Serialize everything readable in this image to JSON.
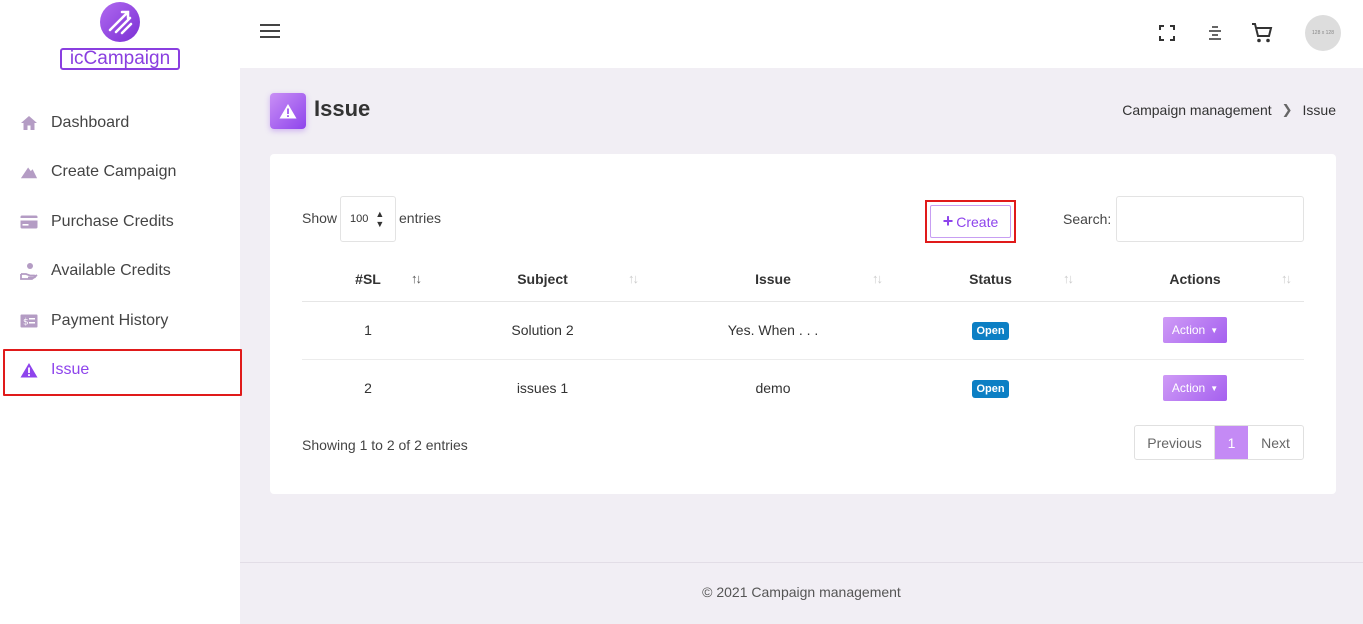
{
  "brand": {
    "logo_text": "icCampaign"
  },
  "sidebar": {
    "items": [
      {
        "label": "Dashboard",
        "icon": "home-icon",
        "active": false
      },
      {
        "label": "Create Campaign",
        "icon": "mountain-icon",
        "active": false
      },
      {
        "label": "Purchase Credits",
        "icon": "credit-card-icon",
        "active": false
      },
      {
        "label": "Available Credits",
        "icon": "hand-coin-icon",
        "active": false
      },
      {
        "label": "Payment History",
        "icon": "money-bill-icon",
        "active": false
      },
      {
        "label": "Issue",
        "icon": "warning-icon",
        "active": true
      }
    ]
  },
  "header": {
    "avatar_text": "128 x 128",
    "icons": [
      "menu-icon",
      "fullscreen-icon",
      "align-center-icon",
      "cart-icon"
    ]
  },
  "page": {
    "title": "Issue",
    "breadcrumb": [
      "Campaign management",
      "Issue"
    ]
  },
  "table_controls": {
    "show_label": "Show",
    "page_size": "100",
    "entries_label": "entries",
    "create_label": "Create",
    "search_label": "Search:",
    "search_value": ""
  },
  "table": {
    "columns": [
      "#SL",
      "Subject",
      "Issue",
      "Status",
      "Actions"
    ],
    "rows": [
      {
        "sl": "1",
        "subject": "Solution 2",
        "issue": "Yes. When . . .",
        "status": "Open",
        "action": "Action"
      },
      {
        "sl": "2",
        "subject": "issues 1",
        "issue": "demo",
        "status": "Open",
        "action": "Action"
      }
    ]
  },
  "pagination": {
    "info": "Showing 1 to 2 of 2 entries",
    "previous": "Previous",
    "current": "1",
    "next": "Next"
  },
  "footer": {
    "text": "© 2021 Campaign management"
  },
  "colors": {
    "accent": "#8e44ec",
    "badge": "#0c7fc4",
    "highlight_border": "#e01a1a"
  }
}
